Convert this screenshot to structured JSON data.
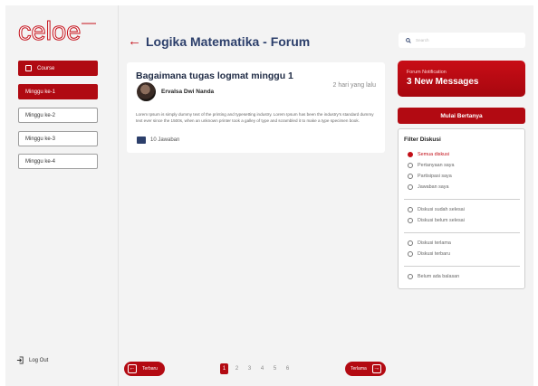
{
  "app": {
    "logo_text": "celoe"
  },
  "sidebar": {
    "course_label": "Course",
    "items": [
      {
        "label": "Minggu ke-1"
      },
      {
        "label": "Minggu ke-2"
      },
      {
        "label": "Minggu ke-3"
      },
      {
        "label": "Minggu ke-4"
      }
    ],
    "logout_label": "Log Out"
  },
  "header": {
    "title": "Logika Matematika - Forum"
  },
  "search": {
    "placeholder": "Search"
  },
  "post": {
    "title": "Bagaimana tugas logmat minggu 1",
    "author": "Ervalsa Dwi Nanda",
    "time": "2 hari yang lalu",
    "body": "Lorem Ipsum is simply dummy text of the printing and typesetting industry. Lorem Ipsum has been the industry's standard dummy text ever since the 1500s, when an unknown printer took a galley of type and scrambled it to make a type specimen book.",
    "replies": "10 Jawaban"
  },
  "notification": {
    "label": "Forum Notification",
    "count_text": "3 New Messages"
  },
  "ask_button": "Mulai Bertanya",
  "filter": {
    "title": "Filter Diskusi",
    "groups": [
      [
        "Semua diskusi",
        "Pertanyaan saya",
        "Partisipasi saya",
        "Jawaban saya"
      ],
      [
        "Diskusi sudah selesai",
        "Diskusi belum selesai"
      ],
      [
        "Diskusi terlama",
        "Diskusi terbaru"
      ],
      [
        "Belum ada balasan"
      ]
    ],
    "selected": "Semua diskusi"
  },
  "pagination": {
    "prev_label": "Terbaru",
    "next_label": "Terlama",
    "pages": [
      "1",
      "2",
      "3",
      "4",
      "5",
      "6"
    ],
    "current": "1"
  },
  "colors": {
    "brand_red": "#b30a12",
    "title_navy": "#2c3f6b"
  }
}
